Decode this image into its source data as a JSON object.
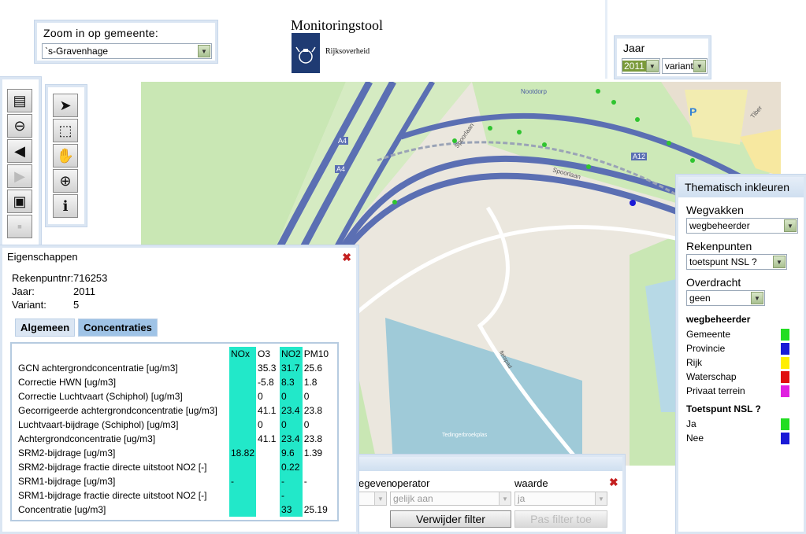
{
  "header": {
    "title": "Monitoringstool",
    "org": "Rijksoverheid"
  },
  "zoom": {
    "label": "Zoom in op gemeente:",
    "value": "`s-Gravenhage"
  },
  "jaar": {
    "label": "Jaar",
    "year": "2011",
    "variant": "variant"
  },
  "toolbar_left": [
    {
      "icon": "layers-icon"
    },
    {
      "icon": "zoom-out-icon"
    },
    {
      "icon": "previous-extent-icon"
    },
    {
      "icon": "next-extent-icon",
      "disabled": true
    },
    {
      "icon": "full-extent-icon"
    },
    {
      "icon": "save-icon",
      "disabled": true
    }
  ],
  "toolbar_mid": [
    {
      "icon": "pointer-icon"
    },
    {
      "icon": "select-icon"
    },
    {
      "icon": "pan-hand-icon"
    },
    {
      "icon": "zoom-in-icon"
    },
    {
      "icon": "info-icon"
    }
  ],
  "map": {
    "labels": {
      "a4_1": "A4",
      "a4_2": "A4",
      "a12": "A12",
      "spoorlaan_1": "Spoorlaan",
      "spoorlaan_2": "Spoorlaan",
      "nootdorp": "Nootdorp",
      "tiber": "Tiber",
      "p": "P",
      "fietspad": "fietspad",
      "plas": "Tedingerbroekplas"
    }
  },
  "thematisch": {
    "title": "Thematisch inkleuren",
    "wegvakken_label": "Wegvakken",
    "wegvakken_value": "wegbeheerder",
    "rekenpunten_label": "Rekenpunten",
    "rekenpunten_value": "toetspunt NSL ?",
    "overdracht_label": "Overdracht",
    "overdracht_value": "geen",
    "legend1_title": "wegbeheerder",
    "legend1": [
      {
        "label": "Gemeente",
        "color": "#22dd22"
      },
      {
        "label": "Provincie",
        "color": "#1a1ad6"
      },
      {
        "label": "Rijk",
        "color": "#ffee00"
      },
      {
        "label": "Waterschap",
        "color": "#e01010"
      },
      {
        "label": "Privaat terrein",
        "color": "#e020e0"
      }
    ],
    "legend2_title": "Toetspunt NSL ?",
    "legend2": [
      {
        "label": "Ja",
        "color": "#22dd22"
      },
      {
        "label": "Nee",
        "color": "#1a1ad6"
      }
    ]
  },
  "eigenschappen": {
    "title": "Eigenschappen",
    "rekenpuntnr_label": "Rekenpuntnr:",
    "rekenpuntnr": "716253",
    "jaar_label": "Jaar:",
    "jaar": "2011",
    "variant_label": "Variant:",
    "variant": "5",
    "tabs": [
      "Algemeen",
      "Concentraties"
    ],
    "columns": [
      "NOx",
      "O3",
      "NO2",
      "PM10"
    ],
    "rows": [
      {
        "label": "GCN achtergrondconcentratie [ug/m3]",
        "nox": "",
        "o3": "35.3",
        "no2": "31.7",
        "pm10": "25.6"
      },
      {
        "label": "Correctie HWN [ug/m3]",
        "nox": "",
        "o3": "-5.8",
        "no2": "8.3",
        "pm10": "1.8"
      },
      {
        "label": "Correctie Luchtvaart (Schiphol) [ug/m3]",
        "nox": "",
        "o3": "0",
        "no2": "0",
        "pm10": "0"
      },
      {
        "label": "Gecorrigeerde achtergrondconcentratie [ug/m3]",
        "nox": "",
        "o3": "41.1",
        "no2": "23.4",
        "pm10": "23.8"
      },
      {
        "label": "Luchtvaart-bijdrage (Schiphol) [ug/m3]",
        "nox": "",
        "o3": "0",
        "no2": "0",
        "pm10": "0"
      },
      {
        "label": "Achtergrondconcentratie [ug/m3]",
        "nox": "",
        "o3": "41.1",
        "no2": "23.4",
        "pm10": "23.8"
      },
      {
        "label": "SRM2-bijdrage [ug/m3]",
        "nox": "18.82",
        "o3": "",
        "no2": "9.6",
        "pm10": "1.39"
      },
      {
        "label": "SRM2-bijdrage fractie directe uitstoot NO2 [-]",
        "nox": "",
        "o3": "",
        "no2": "0.22",
        "pm10": ""
      },
      {
        "label": "SRM1-bijdrage [ug/m3]",
        "nox": "-",
        "o3": "",
        "no2": "-",
        "pm10": "-"
      },
      {
        "label": "SRM1-bijdrage fractie directe uitstoot NO2 [-]",
        "nox": "",
        "o3": "",
        "no2": "-",
        "pm10": ""
      },
      {
        "label": "Concentratie [ug/m3]",
        "nox": "",
        "o3": "",
        "no2": "33",
        "pm10": "25.19"
      }
    ]
  },
  "filter": {
    "col1_label": "egeven",
    "operator_label": "operator",
    "waarde_label": "waarde",
    "operator_value": "gelijk aan",
    "waarde_value": "ja",
    "remove_button": "Verwijder filter",
    "apply_button": "Pas filter toe"
  }
}
